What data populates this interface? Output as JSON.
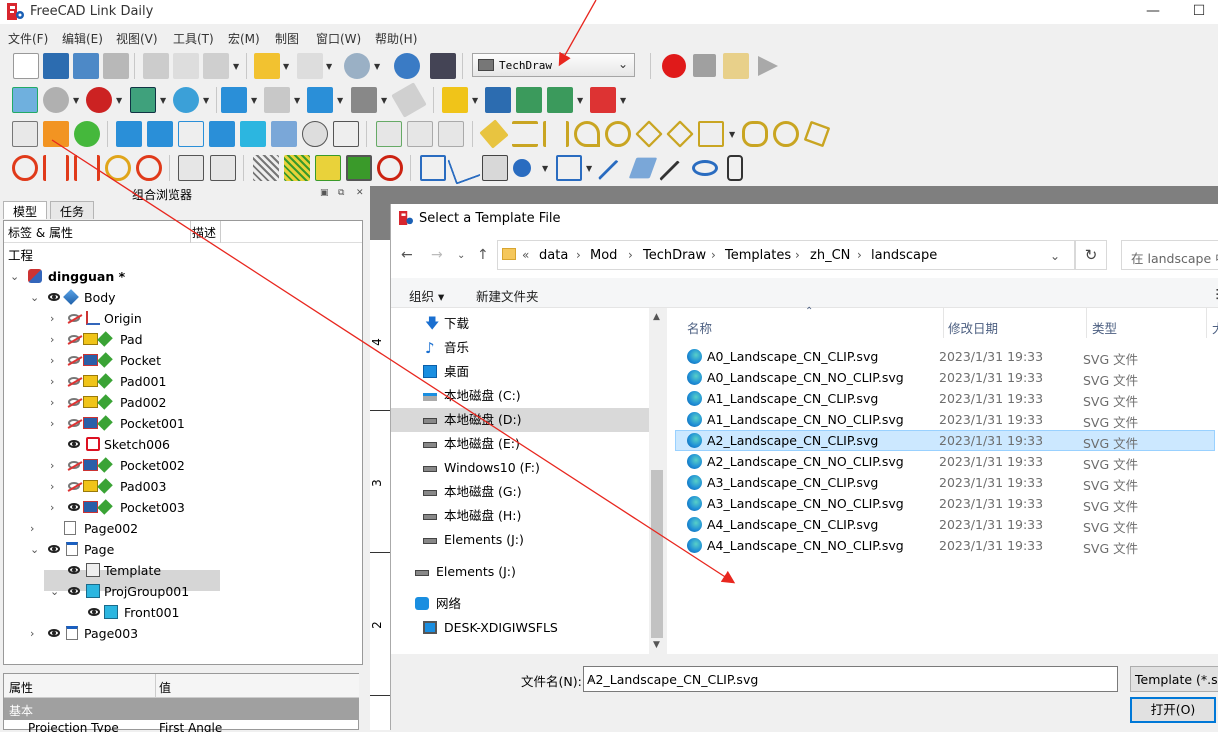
{
  "app": {
    "title": "FreeCAD Link Daily",
    "colors": {
      "accent": "#0078d7",
      "selection": "#cce8ff",
      "annotation": "#e8271f"
    }
  },
  "menubar": {
    "items": [
      "文件(F)",
      "编辑(E)",
      "视图(V)",
      "工具(T)",
      "宏(M)",
      "制图",
      "窗口(W)",
      "帮助(H)"
    ]
  },
  "toolbar": {
    "workbench": "TechDraw"
  },
  "combo_view": {
    "title": "组合浏览器",
    "tabs": [
      "模型",
      "任务"
    ],
    "tree_header": {
      "label": "标签 & 属性",
      "desc": "描述"
    },
    "section": "工程",
    "tree": [
      {
        "label": "dingguan *"
      },
      {
        "label": "Body"
      },
      {
        "label": "Origin"
      },
      {
        "label": "Pad"
      },
      {
        "label": "Pocket"
      },
      {
        "label": "Pad001"
      },
      {
        "label": "Pad002"
      },
      {
        "label": "Pocket001"
      },
      {
        "label": "Sketch006"
      },
      {
        "label": "Pocket002"
      },
      {
        "label": "Pad003"
      },
      {
        "label": "Pocket003"
      },
      {
        "label": "Page002"
      },
      {
        "label": "Page"
      },
      {
        "label": "Template"
      },
      {
        "label": "ProjGroup001"
      },
      {
        "label": "Front001"
      },
      {
        "label": "Page003"
      }
    ],
    "properties": {
      "col_prop": "属性",
      "col_value": "值",
      "group": "基本",
      "partial_row_prop": "Projection Type",
      "partial_row_value": "First Angle"
    }
  },
  "drawing": {
    "ruler": [
      "4",
      "3",
      "2"
    ]
  },
  "dialog": {
    "title": "Select a Template File",
    "breadcrumb": [
      "data",
      "Mod",
      "TechDraw",
      "Templates",
      "zh_CN",
      "landscape"
    ],
    "search_placeholder": "在 landscape 中",
    "commands": {
      "organize": "组织 ▾",
      "new_folder": "新建文件夹"
    },
    "nav": [
      {
        "label": "下载"
      },
      {
        "label": "音乐"
      },
      {
        "label": "桌面"
      },
      {
        "label": "本地磁盘 (C:)"
      },
      {
        "label": "本地磁盘 (D:)"
      },
      {
        "label": "本地磁盘 (E:)"
      },
      {
        "label": "Windows10 (F:)"
      },
      {
        "label": "本地磁盘 (G:)"
      },
      {
        "label": "本地磁盘 (H:)"
      },
      {
        "label": "Elements (J:)"
      },
      {
        "label": "Elements (J:)"
      },
      {
        "label": "网络"
      },
      {
        "label": "DESK-XDIGIWSFLS"
      }
    ],
    "columns": {
      "name": "名称",
      "date": "修改日期",
      "type": "类型",
      "size": "大"
    },
    "files": [
      {
        "name": "A0_Landscape_CN_CLIP.svg",
        "date": "2023/1/31 19:33",
        "type": "SVG 文件"
      },
      {
        "name": "A0_Landscape_CN_NO_CLIP.svg",
        "date": "2023/1/31 19:33",
        "type": "SVG 文件"
      },
      {
        "name": "A1_Landscape_CN_CLIP.svg",
        "date": "2023/1/31 19:33",
        "type": "SVG 文件"
      },
      {
        "name": "A1_Landscape_CN_NO_CLIP.svg",
        "date": "2023/1/31 19:33",
        "type": "SVG 文件"
      },
      {
        "name": "A2_Landscape_CN_CLIP.svg",
        "date": "2023/1/31 19:33",
        "type": "SVG 文件"
      },
      {
        "name": "A2_Landscape_CN_NO_CLIP.svg",
        "date": "2023/1/31 19:33",
        "type": "SVG 文件"
      },
      {
        "name": "A3_Landscape_CN_CLIP.svg",
        "date": "2023/1/31 19:33",
        "type": "SVG 文件"
      },
      {
        "name": "A3_Landscape_CN_NO_CLIP.svg",
        "date": "2023/1/31 19:33",
        "type": "SVG 文件"
      },
      {
        "name": "A4_Landscape_CN_CLIP.svg",
        "date": "2023/1/31 19:33",
        "type": "SVG 文件"
      },
      {
        "name": "A4_Landscape_CN_NO_CLIP.svg",
        "date": "2023/1/31 19:33",
        "type": "SVG 文件"
      }
    ],
    "filename_label": "文件名(N):",
    "filename_value": "A2_Landscape_CN_CLIP.svg",
    "filter": "Template (*.svg)",
    "open_label": "打开(O)"
  }
}
